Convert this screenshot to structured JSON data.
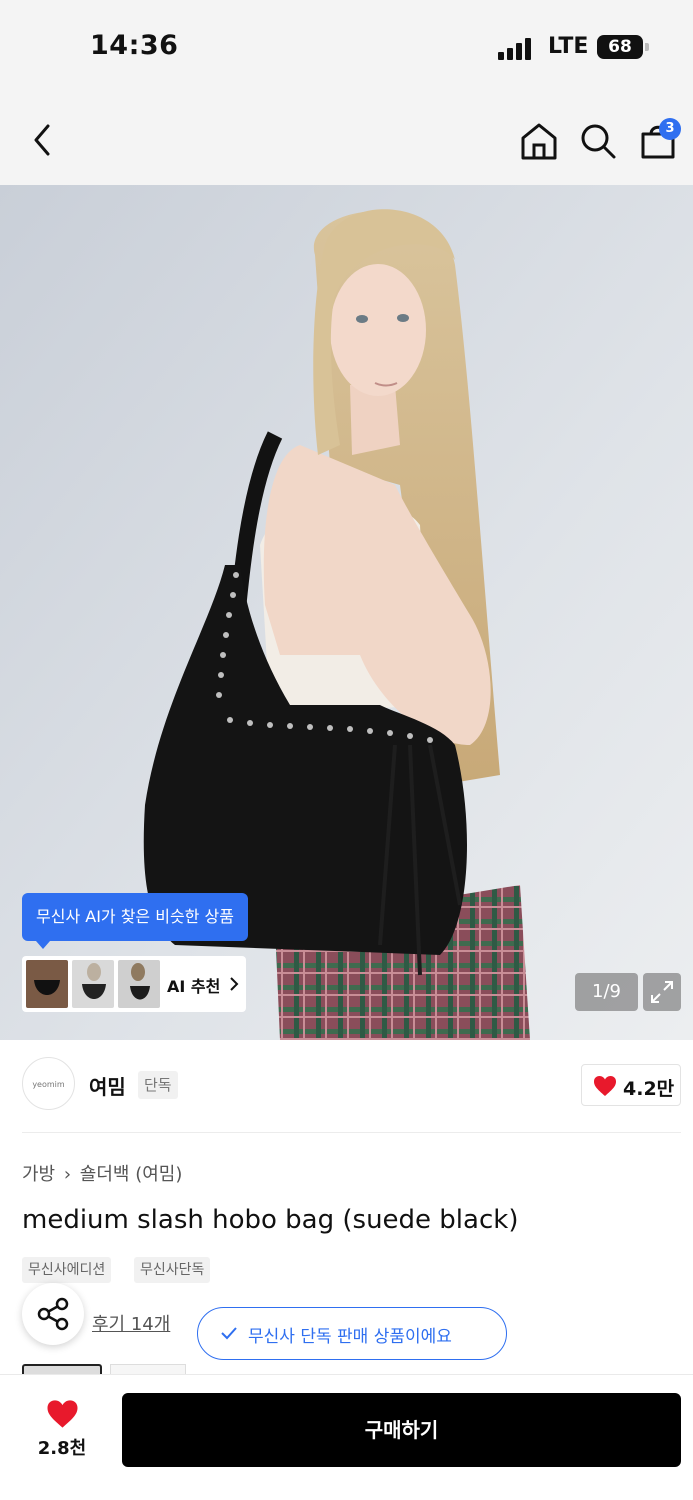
{
  "status_bar": {
    "time": "14:36",
    "network": "LTE",
    "battery": "68"
  },
  "nav": {
    "back_icon": "chevron-left-icon",
    "home_icon": "home-icon",
    "search_icon": "search-icon",
    "cart_icon": "shopping-bag-icon",
    "cart_count": "3"
  },
  "gallery": {
    "ai_tooltip": "무신사 AI가 찾은 비슷한 상품",
    "ai_reco_label": "AI 추천",
    "counter": "1/9",
    "expand_icon": "expand-icon"
  },
  "brand": {
    "logo_text": "yeomim",
    "name": "여밈",
    "tag": "단독",
    "likes": "4.2만"
  },
  "product": {
    "breadcrumb": [
      "가방",
      "숄더백 (여밈)"
    ],
    "title": "medium slash hobo bag (suede black)",
    "tags": [
      "무신사에디션",
      "무신사단독"
    ],
    "reviews": "후기 14개",
    "exclusive_note": "무신사 단독 판매 상품이에요"
  },
  "bottom_bar": {
    "wish_count": "2.8천",
    "buy_label": "구매하기"
  },
  "colors": {
    "accent": "#2f6ff0",
    "heart": "#e8192c",
    "buy_button": "#000000"
  }
}
